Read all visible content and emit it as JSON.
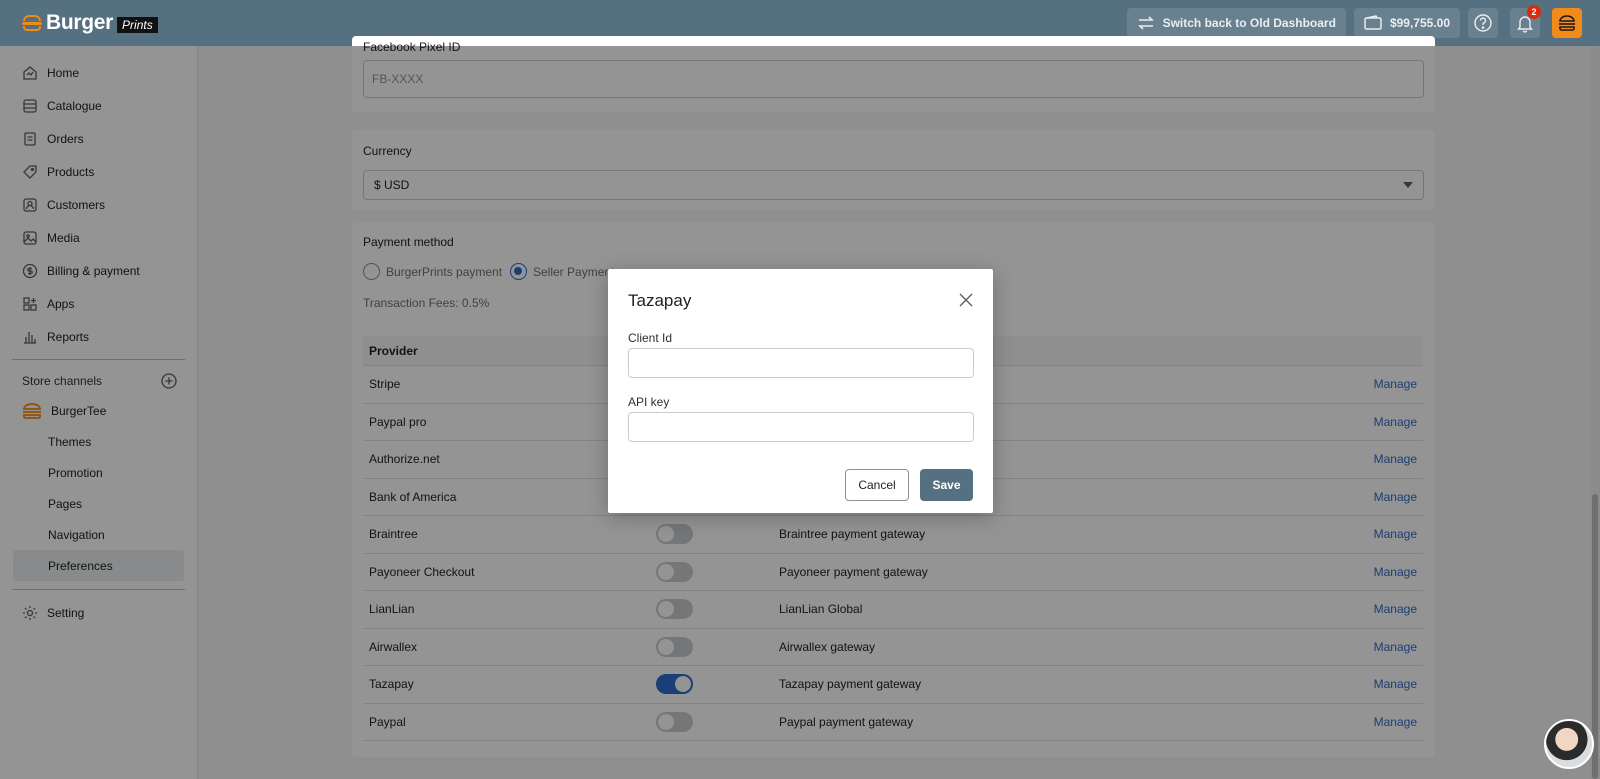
{
  "brand": {
    "name": "Burger",
    "sub": "Prints"
  },
  "topbar": {
    "switch_label": "Switch back to Old Dashboard",
    "balance": "$99,755.00",
    "notification_count": "2"
  },
  "sidebar": {
    "items": [
      {
        "label": "Home",
        "icon": "home-icon"
      },
      {
        "label": "Catalogue",
        "icon": "catalogue-icon"
      },
      {
        "label": "Orders",
        "icon": "orders-icon"
      },
      {
        "label": "Products",
        "icon": "products-icon"
      },
      {
        "label": "Customers",
        "icon": "customers-icon"
      },
      {
        "label": "Media",
        "icon": "media-icon"
      },
      {
        "label": "Billing & payment",
        "icon": "billing-icon"
      },
      {
        "label": "Apps",
        "icon": "apps-icon"
      },
      {
        "label": "Reports",
        "icon": "reports-icon"
      }
    ],
    "channels_label": "Store channels",
    "store_name": "BurgerTee",
    "store_items": [
      "Themes",
      "Promotion",
      "Pages",
      "Navigation",
      "Preferences"
    ],
    "setting_label": "Setting"
  },
  "main": {
    "pixel_label": "Facebook Pixel ID",
    "pixel_placeholder": "FB-XXXX",
    "currency_label": "Currency",
    "currency_value": "$ USD",
    "payment_label": "Payment method",
    "radio_burger": "BurgerPrints payment",
    "radio_seller": "Seller Payment",
    "transaction_fees": "Transaction Fees: 0.5%",
    "provider_header": "Provider",
    "manage_label": "Manage",
    "providers": [
      {
        "name": "Stripe",
        "desc": "",
        "on": false,
        "show_toggle": false
      },
      {
        "name": "Paypal pro",
        "desc": "",
        "on": false,
        "show_toggle": false
      },
      {
        "name": "Authorize.net",
        "desc": "",
        "on": false,
        "show_toggle": false
      },
      {
        "name": "Bank of America",
        "desc": "",
        "on": false,
        "show_toggle": false
      },
      {
        "name": "Braintree",
        "desc": "Braintree payment gateway",
        "on": false,
        "show_toggle": true
      },
      {
        "name": "Payoneer Checkout",
        "desc": "Payoneer payment gateway",
        "on": false,
        "show_toggle": true
      },
      {
        "name": "LianLian",
        "desc": "LianLian Global",
        "on": false,
        "show_toggle": true
      },
      {
        "name": "Airwallex",
        "desc": "Airwallex gateway",
        "on": false,
        "show_toggle": true
      },
      {
        "name": "Tazapay",
        "desc": "Tazapay payment gateway",
        "on": true,
        "show_toggle": true
      },
      {
        "name": "Paypal",
        "desc": "Paypal payment gateway",
        "on": false,
        "show_toggle": true
      }
    ]
  },
  "modal": {
    "title": "Tazapay",
    "client_id_label": "Client Id",
    "client_id_value": "",
    "api_key_label": "API key",
    "api_key_value": "",
    "cancel_label": "Cancel",
    "save_label": "Save"
  },
  "colors": {
    "topbar": "#557080",
    "accent": "#2c6ecb",
    "brand": "#f28a1a"
  }
}
